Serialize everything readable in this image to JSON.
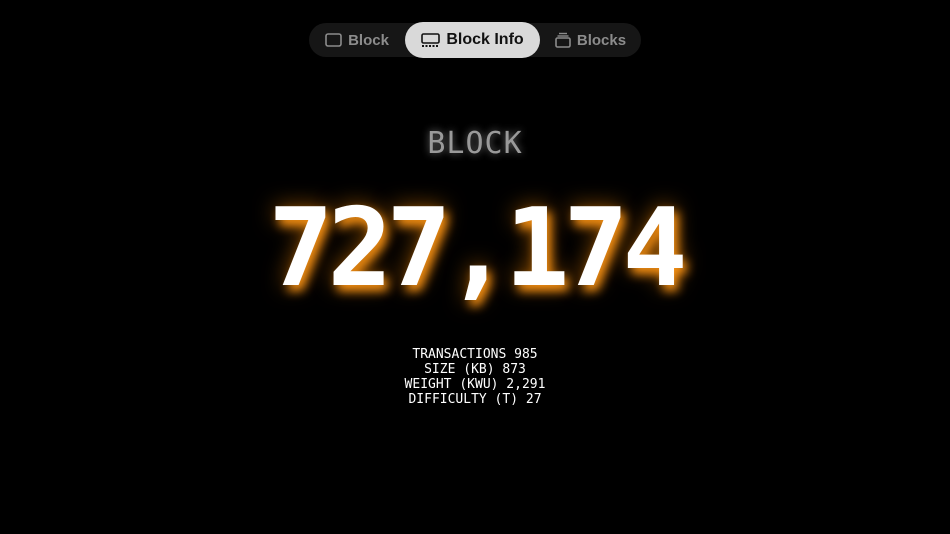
{
  "tabs": [
    {
      "label": "Block",
      "icon": "square-icon",
      "active": false
    },
    {
      "label": "Block Info",
      "icon": "monitor-icon",
      "active": true
    },
    {
      "label": "Blocks",
      "icon": "stack-icon",
      "active": false
    }
  ],
  "block": {
    "label": "BLOCK",
    "height": "727,174"
  },
  "stats": [
    {
      "label": "TRANSACTIONS",
      "value": "985"
    },
    {
      "label": "SIZE (KB)",
      "value": "873"
    },
    {
      "label": "WEIGHT (KWU)",
      "value": "2,291"
    },
    {
      "label": "DIFFICULTY (T)",
      "value": "27"
    }
  ],
  "colors": {
    "background": "#000000",
    "tabbar": "#161616",
    "active_tab": "#d9d9d9",
    "glow": "#ff9614"
  }
}
